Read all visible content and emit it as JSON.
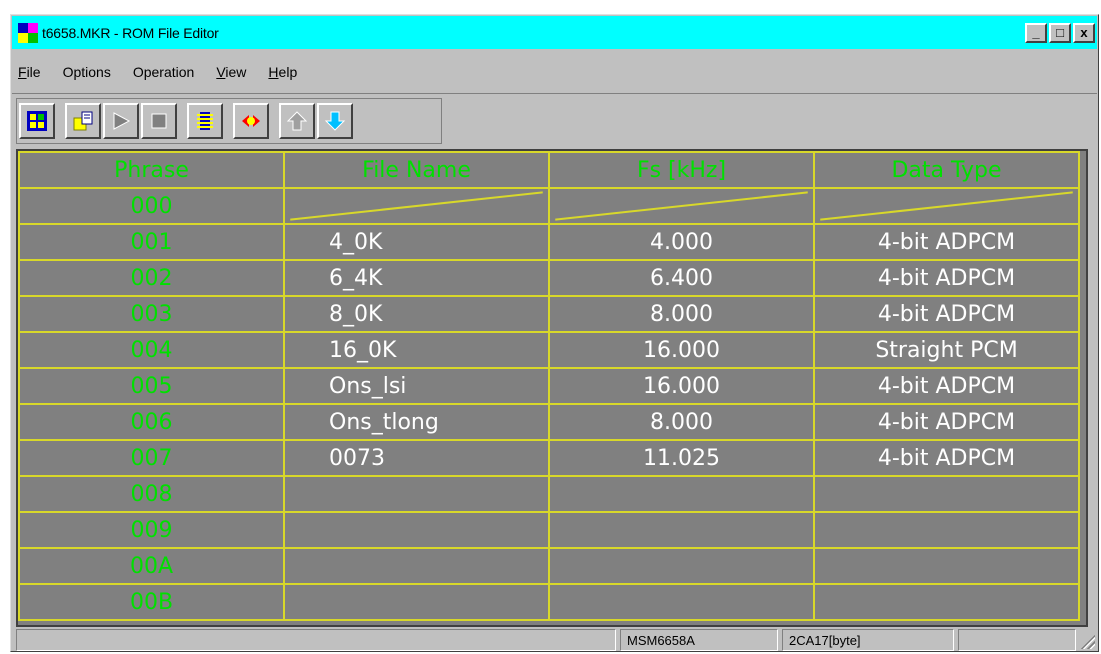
{
  "window": {
    "title": "t6658.MKR - ROM File Editor",
    "controls": {
      "minimize": "_",
      "maximize": "□",
      "close": "x"
    }
  },
  "menu": [
    {
      "underline": "F",
      "rest": "ile"
    },
    {
      "underline": "",
      "rest": "Options"
    },
    {
      "underline": "",
      "rest": "Operation"
    },
    {
      "underline": "V",
      "rest": "iew"
    },
    {
      "underline": "H",
      "rest": "elp"
    }
  ],
  "toolbar": [
    {
      "name": "open-file-icon"
    },
    {
      "name": "new-file-icon"
    },
    {
      "name": "play-icon"
    },
    {
      "name": "stop-icon"
    },
    {
      "name": "chip-icon"
    },
    {
      "name": "convert-icon"
    },
    {
      "name": "move-up-icon"
    },
    {
      "name": "move-down-icon"
    }
  ],
  "grid": {
    "headers": [
      "Phrase",
      "File Name",
      "Fs [kHz]",
      "Data Type"
    ],
    "rows": [
      {
        "phrase": "000",
        "file": "",
        "fs": "",
        "type": "",
        "reserved": true
      },
      {
        "phrase": "001",
        "file": "4_0K",
        "fs": "4.000",
        "type": "4-bit ADPCM"
      },
      {
        "phrase": "002",
        "file": "6_4K",
        "fs": "6.400",
        "type": "4-bit ADPCM"
      },
      {
        "phrase": "003",
        "file": "8_0K",
        "fs": "8.000",
        "type": "4-bit ADPCM"
      },
      {
        "phrase": "004",
        "file": "16_0K",
        "fs": "16.000",
        "type": "Straight PCM"
      },
      {
        "phrase": "005",
        "file": "Ons_lsi",
        "fs": "16.000",
        "type": "4-bit ADPCM"
      },
      {
        "phrase": "006",
        "file": "Ons_tlong",
        "fs": "8.000",
        "type": "4-bit ADPCM"
      },
      {
        "phrase": "007",
        "file": "0073",
        "fs": "11.025",
        "type": "4-bit ADPCM"
      },
      {
        "phrase": "008",
        "file": "",
        "fs": "",
        "type": ""
      },
      {
        "phrase": "009",
        "file": "",
        "fs": "",
        "type": ""
      },
      {
        "phrase": "00A",
        "file": "",
        "fs": "",
        "type": ""
      },
      {
        "phrase": "00B",
        "file": "",
        "fs": "",
        "type": ""
      }
    ]
  },
  "status": {
    "device": "MSM6658A",
    "size": "2CA17[byte]",
    "extra": ""
  },
  "colors": {
    "titlebar": "#00ffff",
    "grid_bg": "#808080",
    "grid_lines": "#d8d82a",
    "phrase_text": "#00e000",
    "cell_text": "#ffffff"
  }
}
